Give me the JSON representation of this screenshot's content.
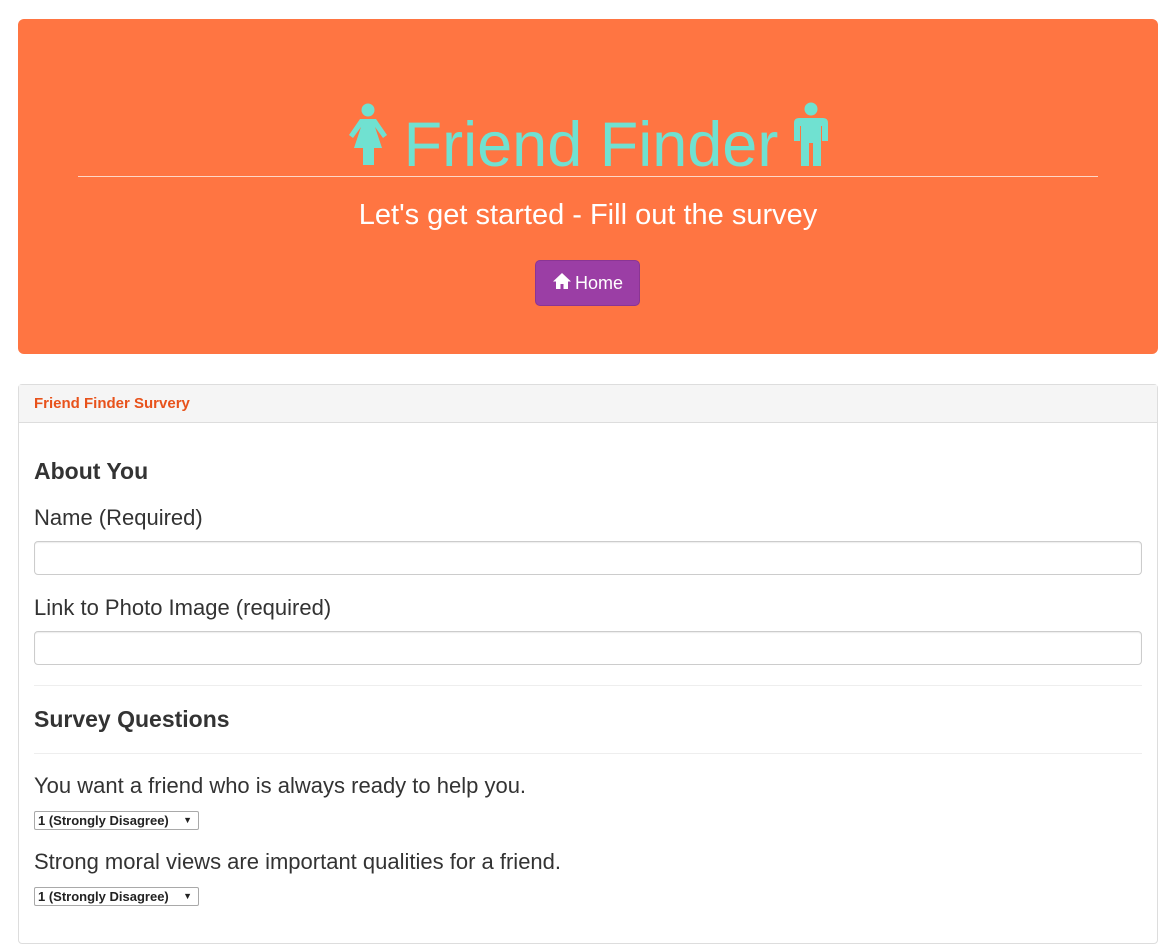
{
  "header": {
    "title": "Friend Finder",
    "subtitle": "Let's get started - Fill out the survey",
    "home_button": "Home",
    "accent_color": "#70e1d1",
    "background_color": "#ff7542",
    "button_color": "#9b3ea5",
    "left_icon": "female-figure-icon",
    "right_icon": "male-figure-icon",
    "home_icon": "home-icon"
  },
  "panel": {
    "heading": "Friend Finder Survery",
    "about_title": "About You",
    "name_label": "Name (Required)",
    "name_value": "",
    "photo_label": "Link to Photo Image (required)",
    "photo_value": "",
    "survey_title": "Survey Questions",
    "questions": [
      {
        "text": "You want a friend who is always ready to help you.",
        "selected": "1 (Strongly Disagree)"
      },
      {
        "text": "Strong moral views are important qualities for a friend.",
        "selected": "1 (Strongly Disagree)"
      }
    ]
  }
}
